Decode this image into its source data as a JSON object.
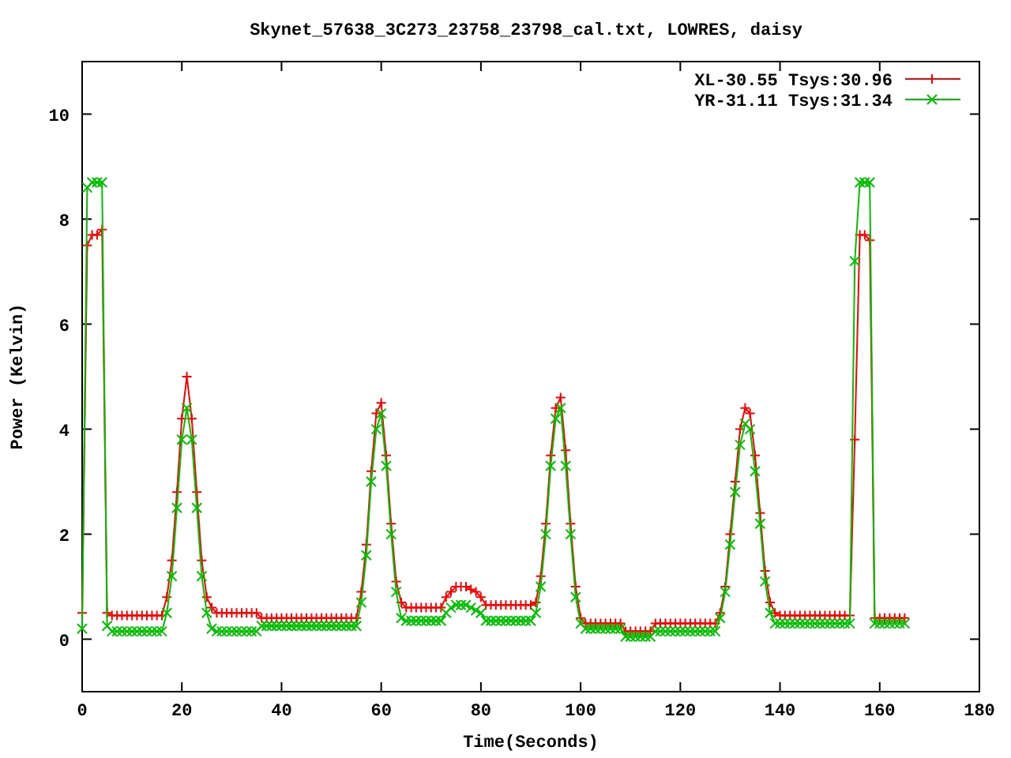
{
  "chart_data": {
    "type": "line",
    "title": "Skynet_57638_3C273_23758_23798_cal.txt, LOWRES, daisy",
    "xlabel": "Time(Seconds)",
    "ylabel": "Power (Kelvin)",
    "xlim": [
      0,
      180
    ],
    "ylim": [
      -1,
      11
    ],
    "xticks": [
      0,
      20,
      40,
      60,
      80,
      100,
      120,
      140,
      160,
      180
    ],
    "yticks": [
      0,
      2,
      4,
      6,
      8,
      10
    ],
    "legend": true,
    "x": [
      0,
      1,
      2,
      3,
      4,
      5,
      6,
      7,
      8,
      9,
      10,
      11,
      12,
      13,
      14,
      15,
      16,
      17,
      18,
      19,
      20,
      21,
      22,
      23,
      24,
      25,
      26,
      27,
      28,
      29,
      30,
      31,
      32,
      33,
      34,
      35,
      36,
      37,
      38,
      39,
      40,
      41,
      42,
      43,
      44,
      45,
      46,
      47,
      48,
      49,
      50,
      51,
      52,
      53,
      54,
      55,
      56,
      57,
      58,
      59,
      60,
      61,
      62,
      63,
      64,
      65,
      66,
      67,
      68,
      69,
      70,
      71,
      72,
      73,
      74,
      75,
      76,
      77,
      78,
      79,
      80,
      81,
      82,
      83,
      84,
      85,
      86,
      87,
      88,
      89,
      90,
      91,
      92,
      93,
      94,
      95,
      96,
      97,
      98,
      99,
      100,
      101,
      102,
      103,
      104,
      105,
      106,
      107,
      108,
      109,
      110,
      111,
      112,
      113,
      114,
      115,
      116,
      117,
      118,
      119,
      120,
      121,
      122,
      123,
      124,
      125,
      126,
      127,
      128,
      129,
      130,
      131,
      132,
      133,
      134,
      135,
      136,
      137,
      138,
      139,
      140,
      141,
      142,
      143,
      144,
      145,
      146,
      147,
      148,
      149,
      150,
      151,
      152,
      153,
      154,
      155,
      156,
      157,
      158,
      159,
      160,
      161,
      162,
      163,
      164,
      165
    ],
    "series": [
      {
        "name": "XL-30.55 Tsys:30.96",
        "color": "#ff0000",
        "marker": "plus",
        "values": [
          0.5,
          7.5,
          7.7,
          7.7,
          7.8,
          0.5,
          0.45,
          0.45,
          0.45,
          0.45,
          0.45,
          0.45,
          0.45,
          0.45,
          0.45,
          0.45,
          0.45,
          0.8,
          1.5,
          2.8,
          4.2,
          5.0,
          4.2,
          2.8,
          1.5,
          0.8,
          0.6,
          0.5,
          0.5,
          0.5,
          0.5,
          0.5,
          0.5,
          0.5,
          0.5,
          0.5,
          0.4,
          0.4,
          0.4,
          0.4,
          0.4,
          0.4,
          0.4,
          0.4,
          0.4,
          0.4,
          0.4,
          0.4,
          0.4,
          0.4,
          0.4,
          0.4,
          0.4,
          0.4,
          0.4,
          0.4,
          0.9,
          1.8,
          3.2,
          4.3,
          4.5,
          3.5,
          2.2,
          1.1,
          0.7,
          0.6,
          0.6,
          0.6,
          0.6,
          0.6,
          0.6,
          0.6,
          0.6,
          0.8,
          0.9,
          1.0,
          1.0,
          1.0,
          0.95,
          0.9,
          0.8,
          0.65,
          0.65,
          0.65,
          0.65,
          0.65,
          0.65,
          0.65,
          0.65,
          0.65,
          0.65,
          0.7,
          1.2,
          2.2,
          3.5,
          4.4,
          4.6,
          3.6,
          2.2,
          1.0,
          0.4,
          0.3,
          0.3,
          0.3,
          0.3,
          0.3,
          0.3,
          0.3,
          0.3,
          0.15,
          0.15,
          0.15,
          0.15,
          0.15,
          0.15,
          0.3,
          0.3,
          0.3,
          0.3,
          0.3,
          0.3,
          0.3,
          0.3,
          0.3,
          0.3,
          0.3,
          0.3,
          0.3,
          0.5,
          1.0,
          2.0,
          3.0,
          4.0,
          4.4,
          4.3,
          3.5,
          2.4,
          1.3,
          0.7,
          0.5,
          0.45,
          0.45,
          0.45,
          0.45,
          0.45,
          0.45,
          0.45,
          0.45,
          0.45,
          0.45,
          0.45,
          0.45,
          0.45,
          0.45,
          0.45,
          3.8,
          7.7,
          7.7,
          7.6,
          0.4,
          0.4,
          0.4,
          0.4,
          0.4,
          0.4,
          0.4
        ]
      },
      {
        "name": "YR-31.11 Tsys:31.34",
        "color": "#00c000",
        "marker": "cross",
        "values": [
          0.2,
          8.6,
          8.7,
          8.7,
          8.7,
          0.25,
          0.15,
          0.15,
          0.15,
          0.15,
          0.15,
          0.15,
          0.15,
          0.15,
          0.15,
          0.15,
          0.15,
          0.5,
          1.2,
          2.5,
          3.8,
          4.4,
          3.8,
          2.5,
          1.2,
          0.5,
          0.2,
          0.15,
          0.15,
          0.15,
          0.15,
          0.15,
          0.15,
          0.15,
          0.15,
          0.15,
          0.25,
          0.25,
          0.25,
          0.25,
          0.25,
          0.25,
          0.25,
          0.25,
          0.25,
          0.25,
          0.25,
          0.25,
          0.25,
          0.25,
          0.25,
          0.25,
          0.25,
          0.25,
          0.25,
          0.25,
          0.7,
          1.6,
          3.0,
          4.0,
          4.3,
          3.3,
          2.0,
          0.9,
          0.4,
          0.35,
          0.35,
          0.35,
          0.35,
          0.35,
          0.35,
          0.35,
          0.35,
          0.5,
          0.6,
          0.65,
          0.65,
          0.65,
          0.6,
          0.55,
          0.5,
          0.35,
          0.35,
          0.35,
          0.35,
          0.35,
          0.35,
          0.35,
          0.35,
          0.35,
          0.35,
          0.5,
          1.0,
          2.0,
          3.3,
          4.2,
          4.4,
          3.3,
          2.0,
          0.8,
          0.3,
          0.2,
          0.2,
          0.2,
          0.2,
          0.2,
          0.2,
          0.2,
          0.2,
          0.05,
          0.05,
          0.05,
          0.05,
          0.05,
          0.05,
          0.15,
          0.15,
          0.15,
          0.15,
          0.15,
          0.15,
          0.15,
          0.15,
          0.15,
          0.15,
          0.15,
          0.15,
          0.15,
          0.4,
          0.9,
          1.8,
          2.8,
          3.7,
          4.1,
          4.0,
          3.2,
          2.2,
          1.1,
          0.5,
          0.3,
          0.3,
          0.3,
          0.3,
          0.3,
          0.3,
          0.3,
          0.3,
          0.3,
          0.3,
          0.3,
          0.3,
          0.3,
          0.3,
          0.3,
          0.3,
          7.2,
          8.7,
          8.7,
          8.7,
          0.3,
          0.3,
          0.3,
          0.3,
          0.3,
          0.3,
          0.3
        ]
      }
    ]
  }
}
